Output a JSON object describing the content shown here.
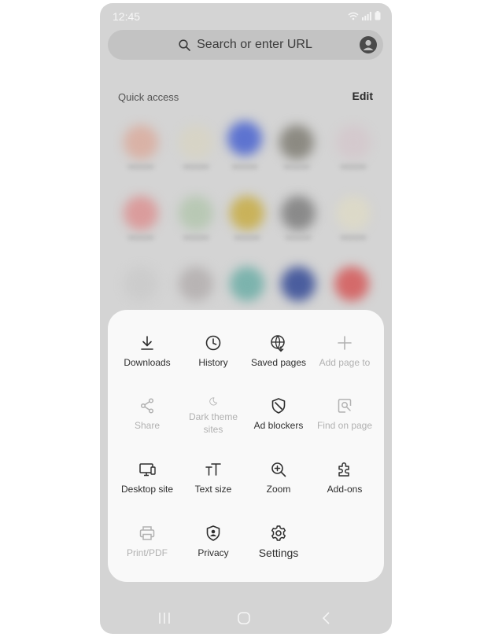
{
  "status_bar": {
    "time": "12:45",
    "icons": [
      "wifi-icon",
      "signal-icon",
      "battery-icon"
    ]
  },
  "search": {
    "placeholder": "Search or enter URL",
    "icon": "search-icon"
  },
  "quick_access": {
    "label": "Quick access",
    "edit_label": "Edit"
  },
  "menu": {
    "items": [
      {
        "label": "Downloads",
        "icon": "download-icon",
        "enabled": true
      },
      {
        "label": "History",
        "icon": "history-icon",
        "enabled": true
      },
      {
        "label": "Saved pages",
        "icon": "saved-pages-icon",
        "enabled": true
      },
      {
        "label": "Add page to",
        "icon": "plus-icon",
        "enabled": false
      },
      {
        "label": "Share",
        "icon": "share-icon",
        "enabled": false
      },
      {
        "label": "Dark theme sites",
        "icon": "moon-icon",
        "enabled": false
      },
      {
        "label": "Ad blockers",
        "icon": "ad-blocker-icon",
        "enabled": true
      },
      {
        "label": "Find on page",
        "icon": "find-on-page-icon",
        "enabled": false
      },
      {
        "label": "Desktop site",
        "icon": "desktop-icon",
        "enabled": true
      },
      {
        "label": "Text size",
        "icon": "text-size-icon",
        "enabled": true
      },
      {
        "label": "Zoom",
        "icon": "zoom-icon",
        "enabled": true
      },
      {
        "label": "Add-ons",
        "icon": "puzzle-icon",
        "enabled": true
      },
      {
        "label": "Print/PDF",
        "icon": "print-icon",
        "enabled": false
      },
      {
        "label": "Privacy",
        "icon": "privacy-icon",
        "enabled": true
      },
      {
        "label": "Settings",
        "icon": "gear-icon",
        "enabled": true
      }
    ]
  },
  "colors": {
    "highlight": "#1366d6",
    "overlay": "#d4d4d4",
    "panel": "#f9f9f9"
  }
}
